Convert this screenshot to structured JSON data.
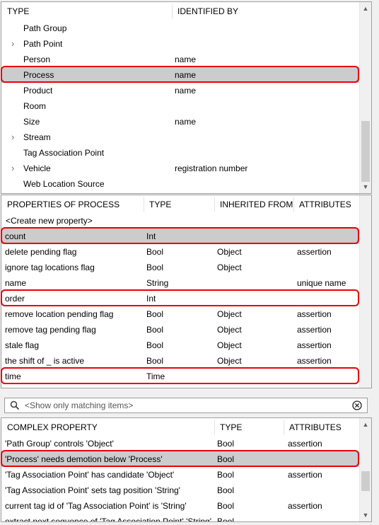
{
  "types_panel": {
    "headers": [
      "TYPE",
      "IDENTIFIED BY"
    ],
    "rows": [
      {
        "name": "Path Group",
        "identified_by": "",
        "expandable": false
      },
      {
        "name": "Path Point",
        "identified_by": "",
        "expandable": true
      },
      {
        "name": "Person",
        "identified_by": "name",
        "expandable": false
      },
      {
        "name": "Process",
        "identified_by": "name",
        "expandable": false,
        "selected": true
      },
      {
        "name": "Product",
        "identified_by": "name",
        "expandable": false
      },
      {
        "name": "Room",
        "identified_by": "",
        "expandable": false
      },
      {
        "name": "Size",
        "identified_by": "name",
        "expandable": false
      },
      {
        "name": "Stream",
        "identified_by": "",
        "expandable": true
      },
      {
        "name": "Tag Association Point",
        "identified_by": "",
        "expandable": false
      },
      {
        "name": "Vehicle",
        "identified_by": "registration number",
        "expandable": true
      },
      {
        "name": "Web Location Source",
        "identified_by": "",
        "expandable": false
      }
    ]
  },
  "properties_panel": {
    "headers": [
      "PROPERTIES OF PROCESS",
      "TYPE",
      "INHERITED FROM",
      "ATTRIBUTES"
    ],
    "create_label": "<Create new property>",
    "rows": [
      {
        "name": "count",
        "type": "Int",
        "inherited": "",
        "attributes": "",
        "selected": true
      },
      {
        "name": "delete pending flag",
        "type": "Bool",
        "inherited": "Object",
        "attributes": "assertion"
      },
      {
        "name": "ignore tag locations flag",
        "type": "Bool",
        "inherited": "Object",
        "attributes": ""
      },
      {
        "name": "name",
        "type": "String",
        "inherited": "",
        "attributes": "unique name"
      },
      {
        "name": "order",
        "type": "Int",
        "inherited": "",
        "attributes": ""
      },
      {
        "name": "remove location pending flag",
        "type": "Bool",
        "inherited": "Object",
        "attributes": "assertion"
      },
      {
        "name": "remove tag pending flag",
        "type": "Bool",
        "inherited": "Object",
        "attributes": "assertion"
      },
      {
        "name": "stale flag",
        "type": "Bool",
        "inherited": "Object",
        "attributes": "assertion"
      },
      {
        "name": "the shift of _ is active",
        "type": "Bool",
        "inherited": "Object",
        "attributes": "assertion"
      },
      {
        "name": "time",
        "type": "Time",
        "inherited": "",
        "attributes": ""
      }
    ]
  },
  "search": {
    "placeholder": "<Show only matching items>",
    "value": ""
  },
  "complex_panel": {
    "headers": [
      "COMPLEX PROPERTY",
      "TYPE",
      "ATTRIBUTES"
    ],
    "rows": [
      {
        "name": "'Path Group' controls 'Object'",
        "type": "Bool",
        "attributes": "assertion"
      },
      {
        "name": "'Process' needs demotion below 'Process'",
        "type": "Bool",
        "attributes": "",
        "selected": true
      },
      {
        "name": "'Tag Association Point' has candidate 'Object'",
        "type": "Bool",
        "attributes": "assertion"
      },
      {
        "name": "'Tag Association Point' sets tag position 'String'",
        "type": "Bool",
        "attributes": ""
      },
      {
        "name": "current tag id of 'Tag Association Point' is 'String'",
        "type": "Bool",
        "attributes": "assertion"
      },
      {
        "name": "extract next sequence of 'Tag Association Point' 'String'",
        "type": "Bool",
        "attributes": ""
      }
    ]
  },
  "colors": {
    "highlight": "#e8000b",
    "selection": "#cccccc"
  }
}
